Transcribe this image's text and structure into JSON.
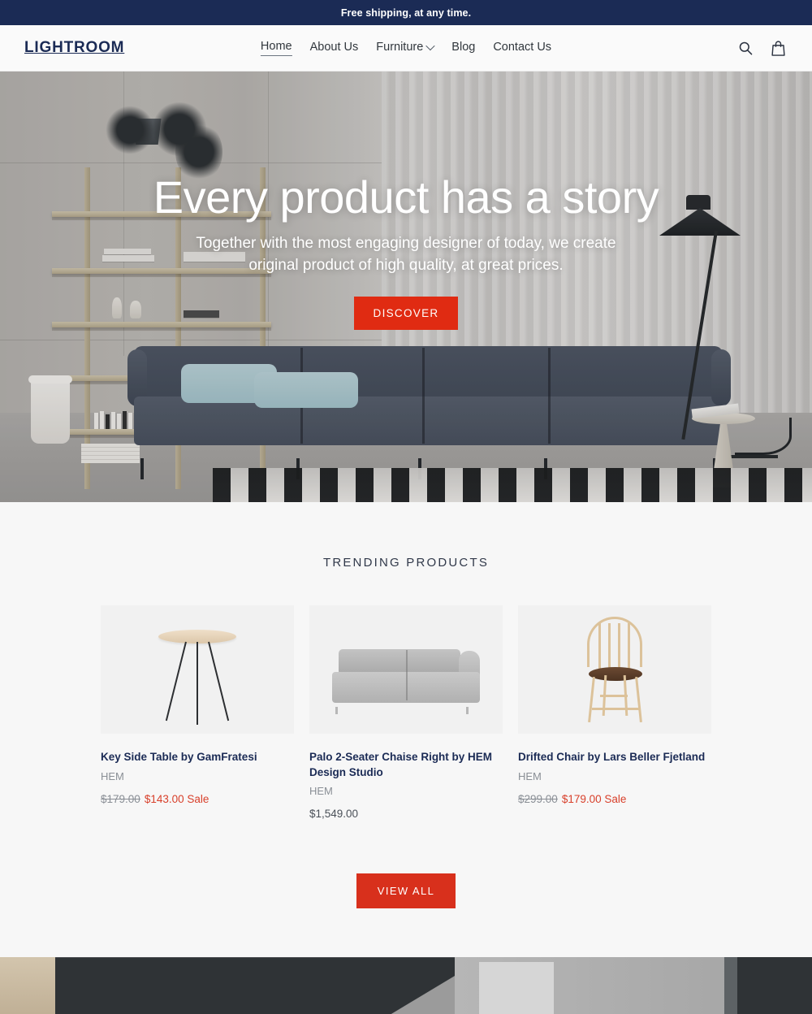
{
  "announcement": {
    "text": "Free shipping, at any time."
  },
  "header": {
    "logo": "LIGHTROOM",
    "nav": [
      {
        "label": "Home",
        "active": true,
        "has_dropdown": false
      },
      {
        "label": "About Us",
        "active": false,
        "has_dropdown": false
      },
      {
        "label": "Furniture",
        "active": false,
        "has_dropdown": true
      },
      {
        "label": "Blog",
        "active": false,
        "has_dropdown": false
      },
      {
        "label": "Contact Us",
        "active": false,
        "has_dropdown": false
      }
    ],
    "icons": [
      {
        "name": "search-icon",
        "label": "Search"
      },
      {
        "name": "shopping-bag-icon",
        "label": "Cart"
      }
    ]
  },
  "hero": {
    "title": "Every product has a story",
    "subtitle": "Together with the most engaging designer of today, we create original product of high quality, at great prices.",
    "cta_label": "DISCOVER",
    "scene_description": "Living room with concrete wall, wooden shelving, navy modular sofa with light blue pillows, black floor lamp and black-and-white striped rug"
  },
  "trending": {
    "title": "TRENDING PRODUCTS",
    "products": [
      {
        "title": "Key Side Table by GamFratesi",
        "vendor": "HEM",
        "price_original": "$179.00",
        "price_current": "$143.00",
        "sale_label": "Sale",
        "on_sale": true,
        "image_alt": "Light wood round side table with three black legs"
      },
      {
        "title": "Palo 2-Seater Chaise Right by HEM Design Studio",
        "vendor": "HEM",
        "price_original": "",
        "price_current": "$1,549.00",
        "sale_label": "",
        "on_sale": false,
        "image_alt": "Grey two-seater chaise sofa with right bolster arm"
      },
      {
        "title": "Drifted Chair by Lars Beller Fjetland",
        "vendor": "HEM",
        "price_original": "$299.00",
        "price_current": "$179.00",
        "sale_label": "Sale",
        "on_sale": true,
        "image_alt": "Light wood spindle-back chair with dark brown seat"
      }
    ],
    "view_all_label": "VIEW ALL"
  },
  "bottom_strip": {
    "description": "Partially visible lifestyle photograph below the fold"
  },
  "colors": {
    "announcement_bg": "#1b2b55",
    "brand_navy": "#1b2b55",
    "accent_red": "#d8301c",
    "hero_cta_red": "#e02b12",
    "sale_red": "#d8402b",
    "section_bg": "#f7f7f7",
    "header_bg": "#fafafa",
    "muted_text": "#8a8f96"
  }
}
